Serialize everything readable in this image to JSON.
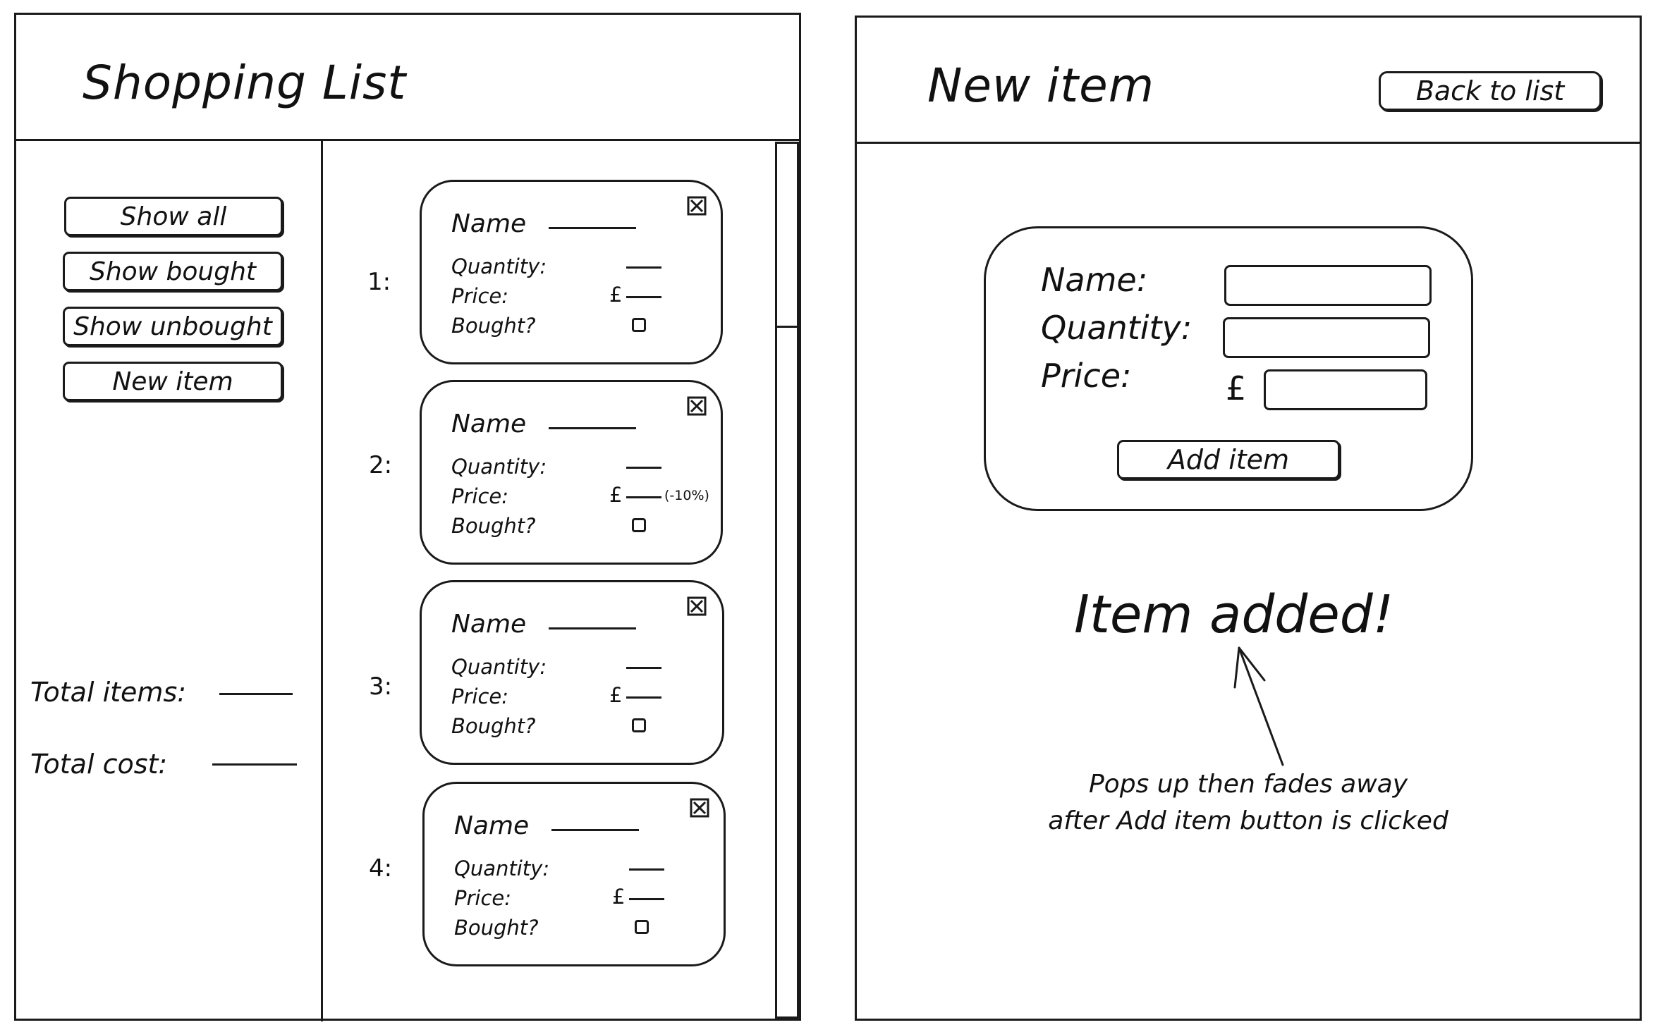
{
  "left_screen": {
    "title": "Shopping List",
    "sidebar": {
      "buttons": [
        "Show all",
        "Show bought",
        "Show unbought",
        "New item"
      ],
      "total_items_label": "Total items:",
      "total_cost_label": "Total cost:"
    },
    "items": [
      {
        "number": "1:",
        "name_label": "Name",
        "quantity_label": "Quantity:",
        "price_label": "Price:",
        "currency": "£",
        "discount": "",
        "bought_label": "Bought?",
        "bought": false
      },
      {
        "number": "2:",
        "name_label": "Name",
        "quantity_label": "Quantity:",
        "price_label": "Price:",
        "currency": "£",
        "discount": "(-10%)",
        "bought_label": "Bought?",
        "bought": false
      },
      {
        "number": "3:",
        "name_label": "Name",
        "quantity_label": "Quantity:",
        "price_label": "Price:",
        "currency": "£",
        "discount": "",
        "bought_label": "Bought?",
        "bought": false
      },
      {
        "number": "4:",
        "name_label": "Name",
        "quantity_label": "Quantity:",
        "price_label": "Price:",
        "currency": "£",
        "discount": "",
        "bought_label": "Bought?",
        "bought": false
      }
    ],
    "icons": {
      "delete": "close-x-box-icon",
      "checkbox": "checkbox-icon"
    }
  },
  "right_screen": {
    "title": "New item",
    "back_button": "Back to list",
    "form": {
      "name_label": "Name:",
      "quantity_label": "Quantity:",
      "price_label": "Price:",
      "currency": "£",
      "submit_label": "Add item",
      "name_value": "",
      "quantity_value": "",
      "price_value": ""
    },
    "toast": "Item added!",
    "annotation": {
      "line1": "Pops up then fades away",
      "line2": "after Add item button is clicked"
    }
  },
  "colors": {
    "ink": "#1a1a1a",
    "paper": "#ffffff"
  }
}
